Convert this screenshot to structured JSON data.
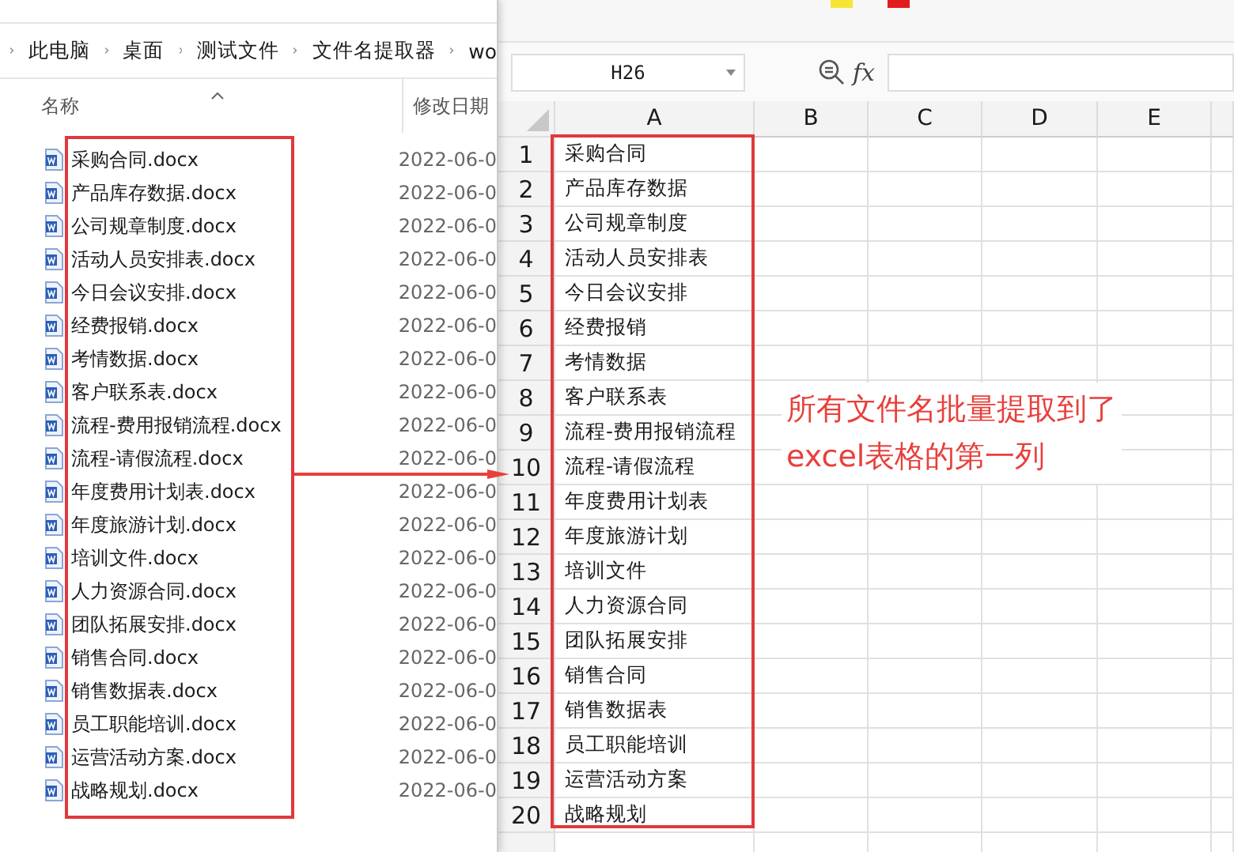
{
  "explorer": {
    "breadcrumb": [
      "此电脑",
      "桌面",
      "测试文件",
      "文件名提取器",
      "wo"
    ],
    "columns": [
      "名称",
      "修改日期"
    ],
    "files": [
      {
        "name": "采购合同.docx",
        "date": "2022-06-0"
      },
      {
        "name": "产品库存数据.docx",
        "date": "2022-06-0"
      },
      {
        "name": "公司规章制度.docx",
        "date": "2022-06-0"
      },
      {
        "name": "活动人员安排表.docx",
        "date": "2022-06-0"
      },
      {
        "name": "今日会议安排.docx",
        "date": "2022-06-0"
      },
      {
        "name": "经费报销.docx",
        "date": "2022-06-0"
      },
      {
        "name": "考情数据.docx",
        "date": "2022-06-0"
      },
      {
        "name": "客户联系表.docx",
        "date": "2022-06-0"
      },
      {
        "name": "流程-费用报销流程.docx",
        "date": "2022-06-0"
      },
      {
        "name": "流程-请假流程.docx",
        "date": "2022-06-0"
      },
      {
        "name": "年度费用计划表.docx",
        "date": "2022-06-0"
      },
      {
        "name": "年度旅游计划.docx",
        "date": "2022-06-0"
      },
      {
        "name": "培训文件.docx",
        "date": "2022-06-0"
      },
      {
        "name": "人力资源合同.docx",
        "date": "2022-06-0"
      },
      {
        "name": "团队拓展安排.docx",
        "date": "2022-06-0"
      },
      {
        "name": "销售合同.docx",
        "date": "2022-06-0"
      },
      {
        "name": "销售数据表.docx",
        "date": "2022-06-0"
      },
      {
        "name": "员工职能培训.docx",
        "date": "2022-06-0"
      },
      {
        "name": "运营活动方案.docx",
        "date": "2022-06-0"
      },
      {
        "name": "战略规划.docx",
        "date": "2022-06-0"
      }
    ]
  },
  "sheet": {
    "name_box": "H26",
    "fx_label": "fx",
    "columns": [
      "A",
      "B",
      "C",
      "D",
      "E"
    ],
    "rows": [
      {
        "number": "1",
        "a": "采购合同"
      },
      {
        "number": "2",
        "a": "产品库存数据"
      },
      {
        "number": "3",
        "a": "公司规章制度"
      },
      {
        "number": "4",
        "a": "活动人员安排表"
      },
      {
        "number": "5",
        "a": "今日会议安排"
      },
      {
        "number": "6",
        "a": "经费报销"
      },
      {
        "number": "7",
        "a": "考情数据"
      },
      {
        "number": "8",
        "a": "客户联系表"
      },
      {
        "number": "9",
        "a": "流程-费用报销流程"
      },
      {
        "number": "10",
        "a": "流程-请假流程"
      },
      {
        "number": "11",
        "a": "年度费用计划表"
      },
      {
        "number": "12",
        "a": "年度旅游计划"
      },
      {
        "number": "13",
        "a": "培训文件"
      },
      {
        "number": "14",
        "a": "人力资源合同"
      },
      {
        "number": "15",
        "a": "团队拓展安排"
      },
      {
        "number": "16",
        "a": "销售合同"
      },
      {
        "number": "17",
        "a": "销售数据表"
      },
      {
        "number": "18",
        "a": "员工职能培训"
      },
      {
        "number": "19",
        "a": "运营活动方案"
      },
      {
        "number": "20",
        "a": "战略规划"
      }
    ]
  },
  "annotation": [
    "所有文件名批量提取到了",
    "excel表格的第一列"
  ]
}
